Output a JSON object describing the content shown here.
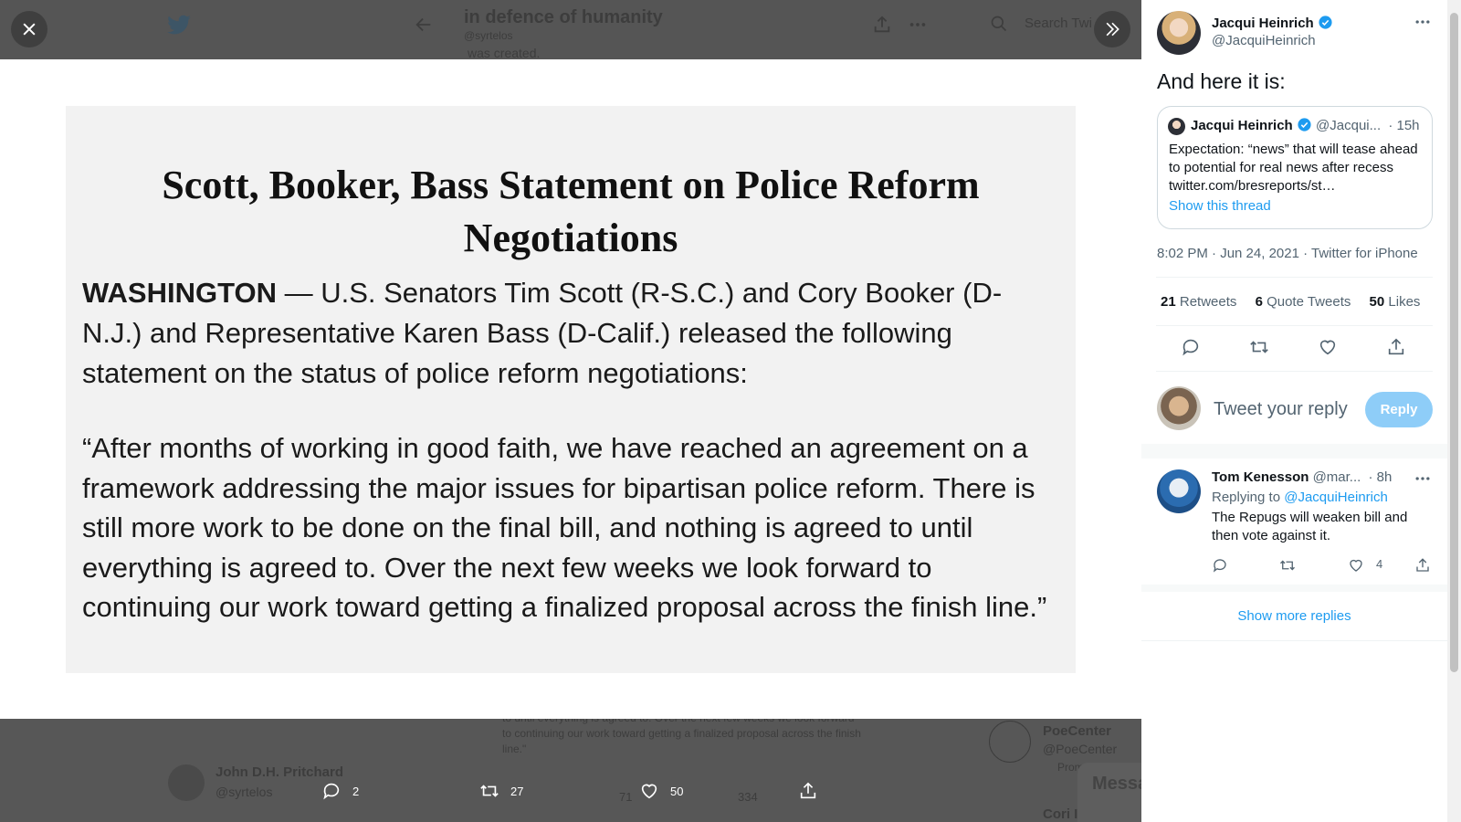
{
  "background_page": {
    "title": "in defence of humanity",
    "handle": "@syrtelos",
    "snippet": "was created.",
    "search_placeholder": "Search Twi",
    "bottom_quote_snippet_1": "to until everything is agreed to. Over the next few weeks we look forward",
    "bottom_quote_snippet_2": "to continuing our work toward getting a finalized proposal across the finish",
    "bottom_quote_snippet_3": "line.\"",
    "author_name": "John D.H. Pritchard",
    "author_handle": "@syrtelos",
    "side_name_1": "PoeCenter",
    "side_handle_1": "@PoeCenter",
    "side_promoted": "Promoted",
    "side_name_2": "Cori I",
    "messages_label": "Messa",
    "bg_count_1": "71",
    "bg_count_2": "334"
  },
  "viewer": {
    "statement_title_line1": "Scott, Booker, Bass Statement on Police Reform",
    "statement_title_line2": "Negotiations",
    "statement_dateline": "WASHINGTON",
    "statement_lead": " — U.S. Senators Tim Scott (R-S.C.) and Cory Booker (D-N.J.) and Representative Karen Bass (D-Calif.) released the following statement on the status of police reform negotiations:",
    "statement_quote": "“After months of working in good faith, we have reached an agreement on a framework addressing the major issues for bipartisan police reform. There is still more work to be done on the final bill, and nothing is agreed to until everything is agreed to. Over the next few weeks we look forward to continuing our work toward getting a finalized proposal across the finish line.”",
    "actions": {
      "reply_count": "2",
      "retweet_count": "27",
      "like_count": "50"
    }
  },
  "tweet": {
    "author_name": "Jacqui Heinrich",
    "author_handle": "@JacquiHeinrich",
    "text": "And here it is:",
    "quoted": {
      "author_name": "Jacqui Heinrich",
      "author_handle": "@Jacqui...",
      "time": "· 15h",
      "text": "Expectation: “news” that will tease ahead to potential for real news after recess twitter.com/bresreports/st…",
      "show_thread": "Show this thread"
    },
    "timestamp": "8:02 PM · Jun 24, 2021 · Twitter for iPhone",
    "stats": {
      "retweets_count": "21",
      "retweets_label": "Retweets",
      "quote_tweets_count": "6",
      "quote_tweets_label": "Quote Tweets",
      "likes_count": "50",
      "likes_label": "Likes"
    },
    "reply_box": {
      "placeholder": "Tweet your reply",
      "button": "Reply"
    }
  },
  "replies": [
    {
      "author_name": "Tom Kenesson",
      "author_handle": "@mar...",
      "time": "· 8h",
      "replying_to_label": "Replying to",
      "replying_to_handle": "@JacquiHeinrich",
      "text": "The Repugs will weaken bill and then vote against it.",
      "like_count": "4"
    }
  ],
  "show_more_replies": "Show more replies",
  "colors": {
    "accent": "#1d9bf0",
    "reply_button_disabled": "#8ecdf8",
    "text_secondary": "#536471"
  }
}
